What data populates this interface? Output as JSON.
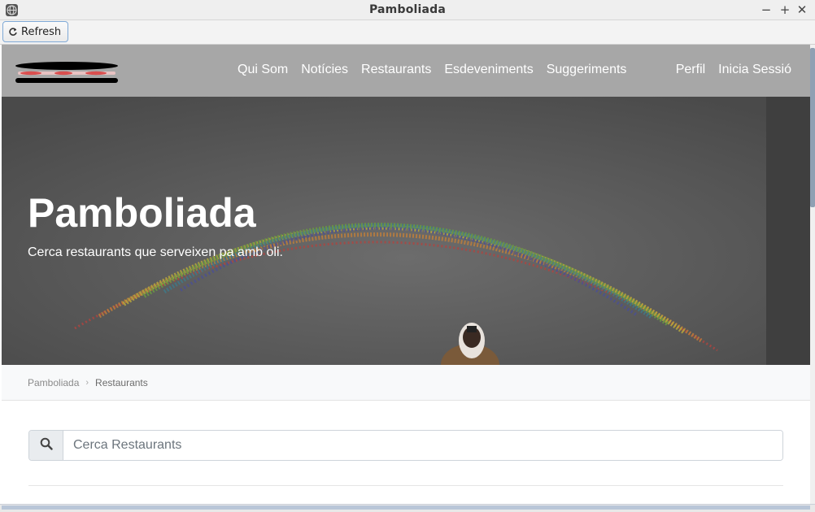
{
  "window": {
    "title": "Pamboliada",
    "minimize_symbol": "−",
    "maximize_symbol": "+",
    "close_symbol": "✕",
    "app_icon": "globe-icon"
  },
  "toolbar": {
    "refresh_label": "Refresh",
    "refresh_icon": "refresh-icon"
  },
  "navbar": {
    "logo": "logo",
    "links": [
      "Qui Som",
      "Notícies",
      "Restaurants",
      "Esdeveniments",
      "Suggeriments"
    ],
    "right_links": [
      "Perfil",
      "Inicia Sessió"
    ]
  },
  "hero": {
    "title": "Pamboliada",
    "subtitle": "Cerca restaurants que serveixen pa amb oli."
  },
  "breadcrumb": {
    "home": "Pamboliada",
    "separator": "›",
    "current": "Restaurants"
  },
  "search": {
    "placeholder": "Cerca Restaurants",
    "value": "",
    "icon": "search-icon"
  },
  "colors": {
    "navbar_bg": "#a7a7a7",
    "hero_overlay": "#585858",
    "breadcrumb_bg": "#f8f9fa",
    "refresh_border": "#7fa9d6"
  }
}
